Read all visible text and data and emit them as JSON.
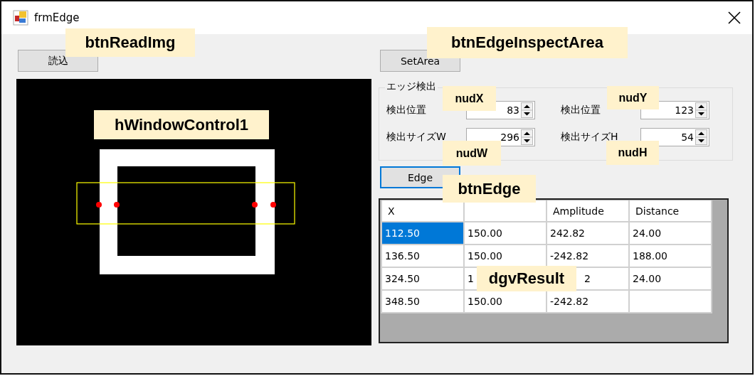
{
  "window": {
    "title": "frmEdge"
  },
  "read_button": {
    "label": "読込"
  },
  "set_area_button": {
    "label": "SetArea"
  },
  "group": {
    "title": "エッジ検出",
    "fields": [
      {
        "label": "検出位置",
        "value": "83"
      },
      {
        "label": "検出位置",
        "value": "123"
      },
      {
        "label": "検出サイズW",
        "value": "296"
      },
      {
        "label": "検出サイズH",
        "value": "54"
      }
    ]
  },
  "edge_button": {
    "label": "Edge",
    "focused": true
  },
  "table": {
    "columns": [
      {
        "text": "X"
      },
      {},
      {
        "text": "Amplitude"
      },
      {
        "text": "Distance"
      }
    ],
    "rows": [
      {
        "cells": [
          {
            "text": "112.50",
            "selected": true
          },
          {
            "text": "150.00",
            "selected": false
          },
          {
            "text": "242.82",
            "selected": false
          },
          {
            "text": "24.00",
            "selected": false
          }
        ]
      },
      {
        "cells": [
          {
            "text": "136.50",
            "selected": false
          },
          {
            "text": "150.00",
            "selected": false
          },
          {
            "text": "-242.82",
            "selected": false
          },
          {
            "text": "188.00",
            "selected": false
          }
        ]
      },
      {
        "cells": [
          {
            "text": "324.50",
            "selected": false
          },
          {
            "text": "1",
            "selected": false
          },
          {
            "text": "2",
            "kind": "tail",
            "selected": false
          },
          {
            "text": "24.00",
            "selected": false
          }
        ]
      },
      {
        "cells": [
          {
            "text": "348.50",
            "selected": false
          },
          {
            "text": "150.00",
            "selected": false
          },
          {
            "text": "-242.82",
            "selected": false
          },
          {
            "selected": false
          }
        ]
      }
    ]
  },
  "callouts": [
    "btnReadImg",
    "btnEdgeInspectArea",
    "hWindowControl1",
    "nudX",
    "nudY",
    "nudW",
    "nudH",
    "btnEdge",
    "dgvResult"
  ]
}
